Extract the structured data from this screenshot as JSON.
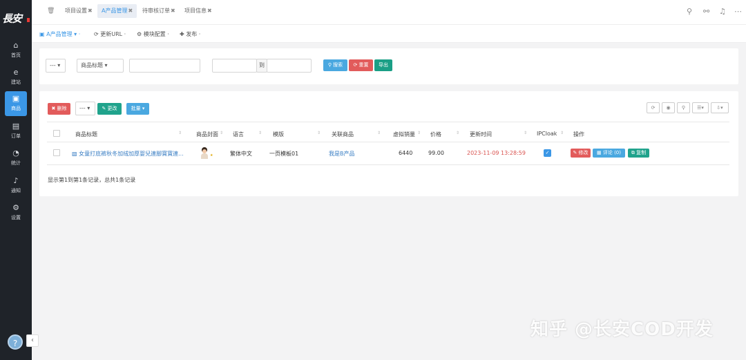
{
  "sidebar": {
    "logo": "長安",
    "items": [
      {
        "label": "首页",
        "icon": "home-icon",
        "glyph": "⌂"
      },
      {
        "label": "建站",
        "icon": "browser-icon",
        "glyph": "e"
      },
      {
        "label": "商品",
        "icon": "bag-icon",
        "glyph": "▣"
      },
      {
        "label": "订单",
        "icon": "document-icon",
        "glyph": "▤"
      },
      {
        "label": "统计",
        "icon": "pie-chart-icon",
        "glyph": "◔"
      },
      {
        "label": "通知",
        "icon": "bell-icon",
        "glyph": "♪"
      },
      {
        "label": "设置",
        "icon": "gears-icon",
        "glyph": "⚙"
      }
    ],
    "avatar_glyph": "?",
    "collapse_glyph": "‹"
  },
  "tabs": [
    {
      "label": "项目设置"
    },
    {
      "label": "A产品管理"
    },
    {
      "label": "待审核订单"
    },
    {
      "label": "项目信息"
    }
  ],
  "subnav": {
    "product": "A产品管理",
    "update_url": "更新URL",
    "module": "模块配置",
    "publish": "发布"
  },
  "search": {
    "select1": "---",
    "field_select": "商品标题",
    "range_to": "到",
    "search_btn": "搜索",
    "reset_btn": "重置",
    "export_btn": "导出"
  },
  "toolbar": {
    "delete_btn": "删除",
    "select": "---",
    "change_btn": "更改",
    "batch_btn": "批量"
  },
  "table": {
    "columns": [
      "商品标题",
      "商品封面",
      "语言",
      "模版",
      "关联商品",
      "虚拟销量",
      "价格",
      "更新时间",
      "IPCloak",
      "操作"
    ],
    "rows": [
      {
        "title": "女童打底裤秋冬加绒加厚婴兒連腳寶寶連...",
        "language": "繁体中文",
        "template": "一页模板01",
        "linked": "我是B产品",
        "sales": "6440",
        "price": "99.00",
        "updated": "2023-11-09 13:28:59",
        "actions": {
          "edit": "修改",
          "review": "评论 (0)",
          "copy": "复制"
        }
      }
    ],
    "footer": "显示第1到第1条记录，总共1条记录"
  },
  "watermark": "知乎 @长安COD开发",
  "colors": {
    "accent": "#3b97e6",
    "danger": "#e25b5b",
    "success": "#1a9f86",
    "sidebar": "#1f2329"
  }
}
